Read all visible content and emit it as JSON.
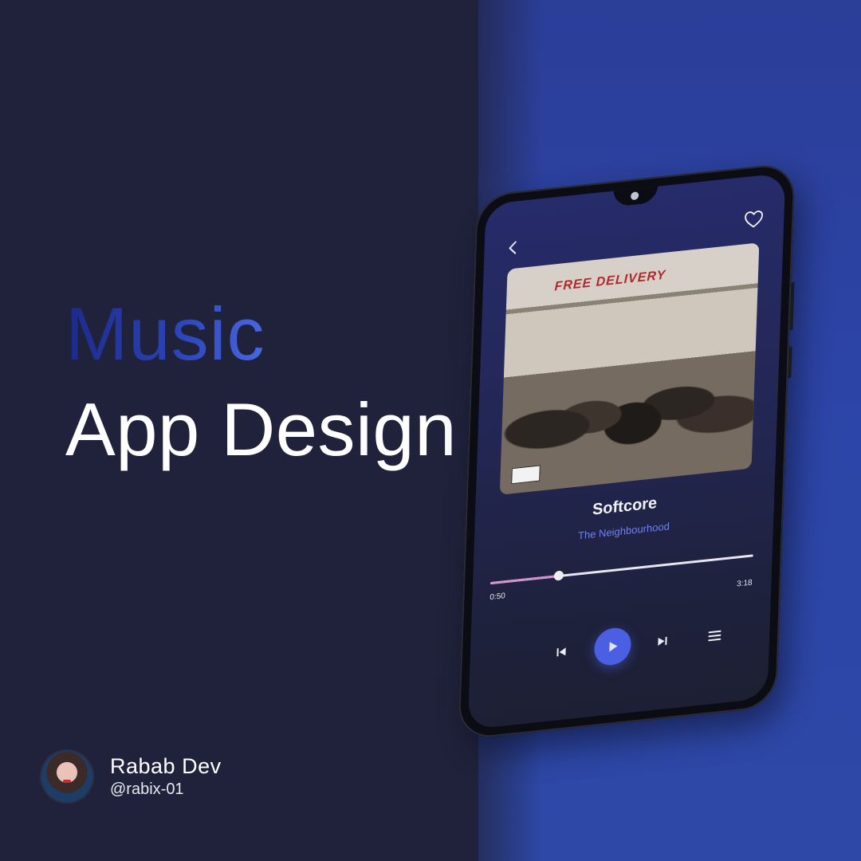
{
  "headline": {
    "line1": "Music",
    "line2": "App Design"
  },
  "author": {
    "name": "Rabab Dev",
    "handle": "@rabix-01"
  },
  "player": {
    "album_sign_text": "FREE DELIVERY",
    "song_title": "Softcore",
    "artist": "The Neighbourhood",
    "time_elapsed": "0:50",
    "time_total": "3:18",
    "progress": 0.26
  },
  "icons": {
    "back": "chevron-left-icon",
    "favorite": "heart-icon",
    "previous": "skip-previous-icon",
    "play": "play-icon",
    "next": "skip-next-icon",
    "queue": "menu-icon"
  },
  "colors": {
    "background": "#20223b",
    "accent": "#4b5fe2",
    "artist_text": "#6f82f3",
    "progress_fill": "#d895c6"
  }
}
